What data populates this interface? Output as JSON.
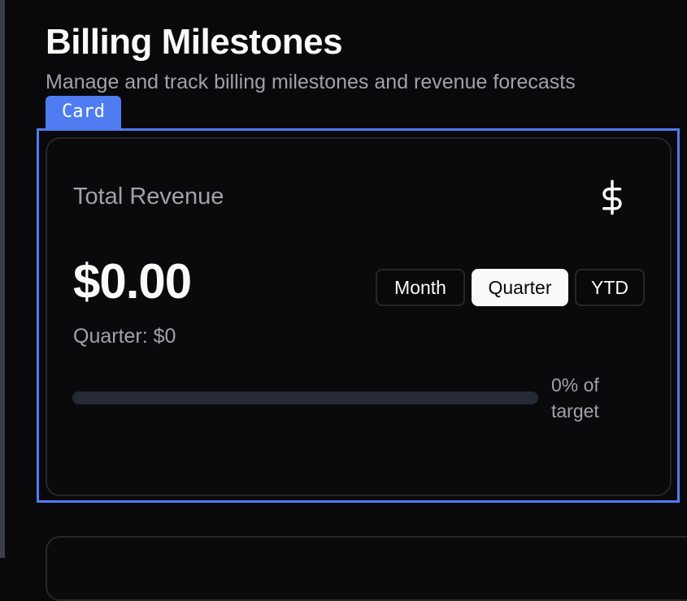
{
  "page": {
    "title": "Billing Milestones",
    "subtitle": "Manage and track billing milestones and revenue forecasts"
  },
  "overlay": {
    "tag_label": "Card",
    "accent_color": "#4f7df1"
  },
  "revenue_card": {
    "label": "Total Revenue",
    "icon": "dollar-sign-icon",
    "value": "$0.00",
    "period_summary": "Quarter: $0",
    "periods": [
      {
        "label": "Month",
        "active": false
      },
      {
        "label": "Quarter",
        "active": true
      },
      {
        "label": "YTD",
        "active": false
      }
    ],
    "progress_percent": 0,
    "progress_text": "0% of target"
  }
}
